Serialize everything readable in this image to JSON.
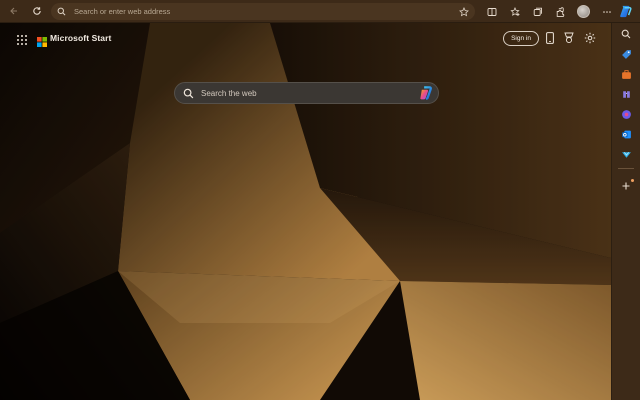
{
  "browser": {
    "address_placeholder": "Search or enter web address"
  },
  "header": {
    "brand": "Microsoft Start",
    "sign_in": "Sign in"
  },
  "search": {
    "placeholder": "Search the web"
  },
  "icons": {
    "toolbar": [
      "back-icon",
      "refresh-icon",
      "search-icon",
      "favorite-star-icon",
      "split-screen-icon",
      "favorites-icon",
      "collections-icon",
      "extensions-icon",
      "profile-avatar",
      "more-icon",
      "copilot-icon"
    ],
    "header": [
      "apps-launcher-icon",
      "microsoft-logo",
      "phone-icon",
      "rewards-icon",
      "settings-gear-icon"
    ],
    "sidebar": [
      "search-icon",
      "shopping-tag-icon",
      "tools-briefcase-icon",
      "games-icon",
      "copilot-designer-icon",
      "outlook-icon",
      "drop-icon",
      "add-icon"
    ]
  },
  "colors": {
    "browser_frame": "#3d2a18",
    "address_bar": "#4a3520",
    "page_bg_dark": "#120b05",
    "accent_gold": "#c8914a",
    "search_box": "#3b3733"
  }
}
